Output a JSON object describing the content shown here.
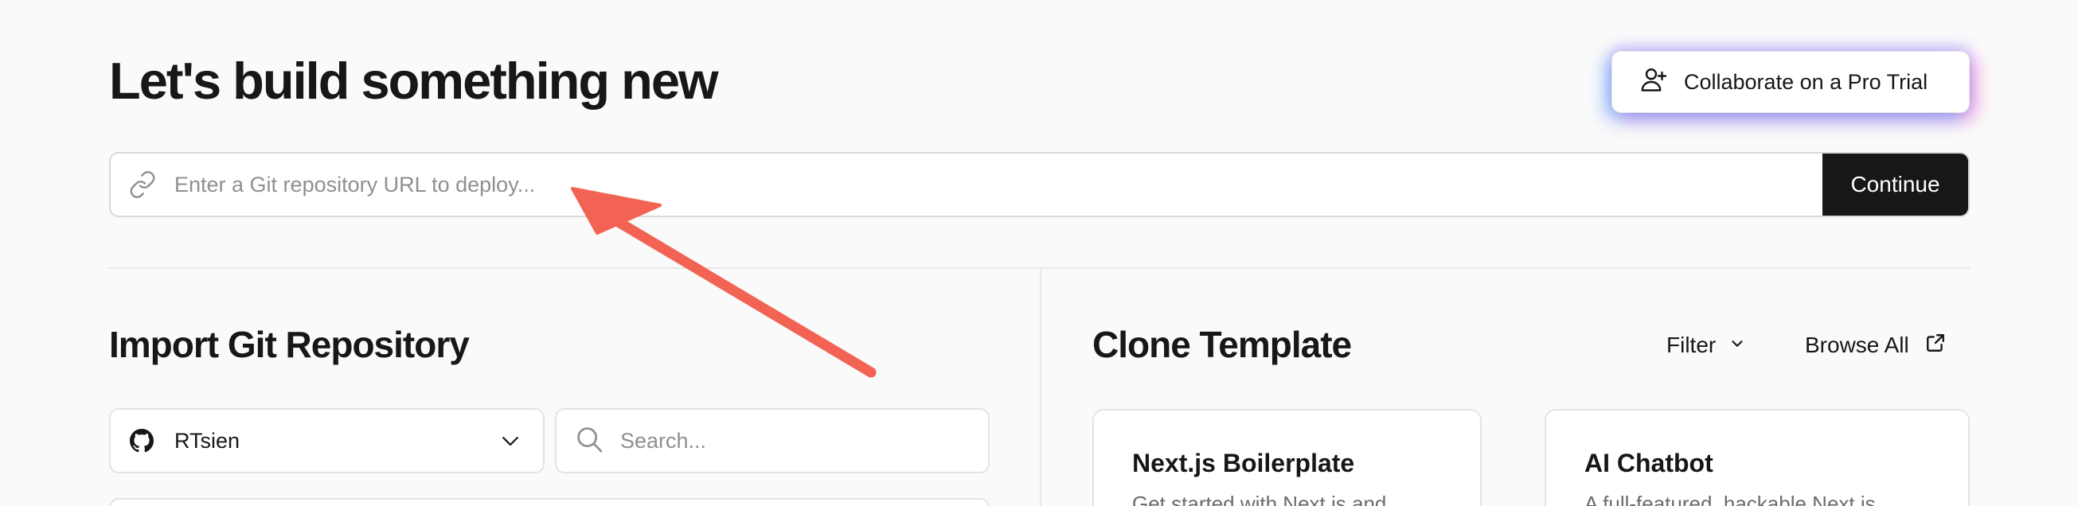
{
  "header": {
    "title": "Let's build something new",
    "pro_trial_label": "Collaborate on a Pro Trial"
  },
  "git_import": {
    "placeholder": "Enter a Git repository URL to deploy...",
    "value": "",
    "continue_label": "Continue"
  },
  "import_section": {
    "title": "Import Git Repository",
    "account": "RTsien",
    "search_placeholder": "Search..."
  },
  "clone_section": {
    "title": "Clone Template",
    "filter_label": "Filter",
    "browse_label": "Browse All",
    "templates": [
      {
        "title": "Next.js Boilerplate",
        "description": "Get started with Next.js and"
      },
      {
        "title": "AI Chatbot",
        "description": "A full-featured, hackable Next.js"
      }
    ]
  },
  "icons": {
    "pro_trial": "user-plus-icon",
    "git_input": "link-icon",
    "account": "github-icon",
    "account_dropdown": "chevron-down-icon",
    "search": "search-icon",
    "filter": "chevron-down-icon",
    "browse": "external-link-icon"
  },
  "colors": {
    "background": "#fafafa",
    "primary_button": "#171717",
    "annotation_arrow": "#f26353",
    "glow_blue": "#4696ff",
    "glow_pink": "#ec5ad2"
  }
}
